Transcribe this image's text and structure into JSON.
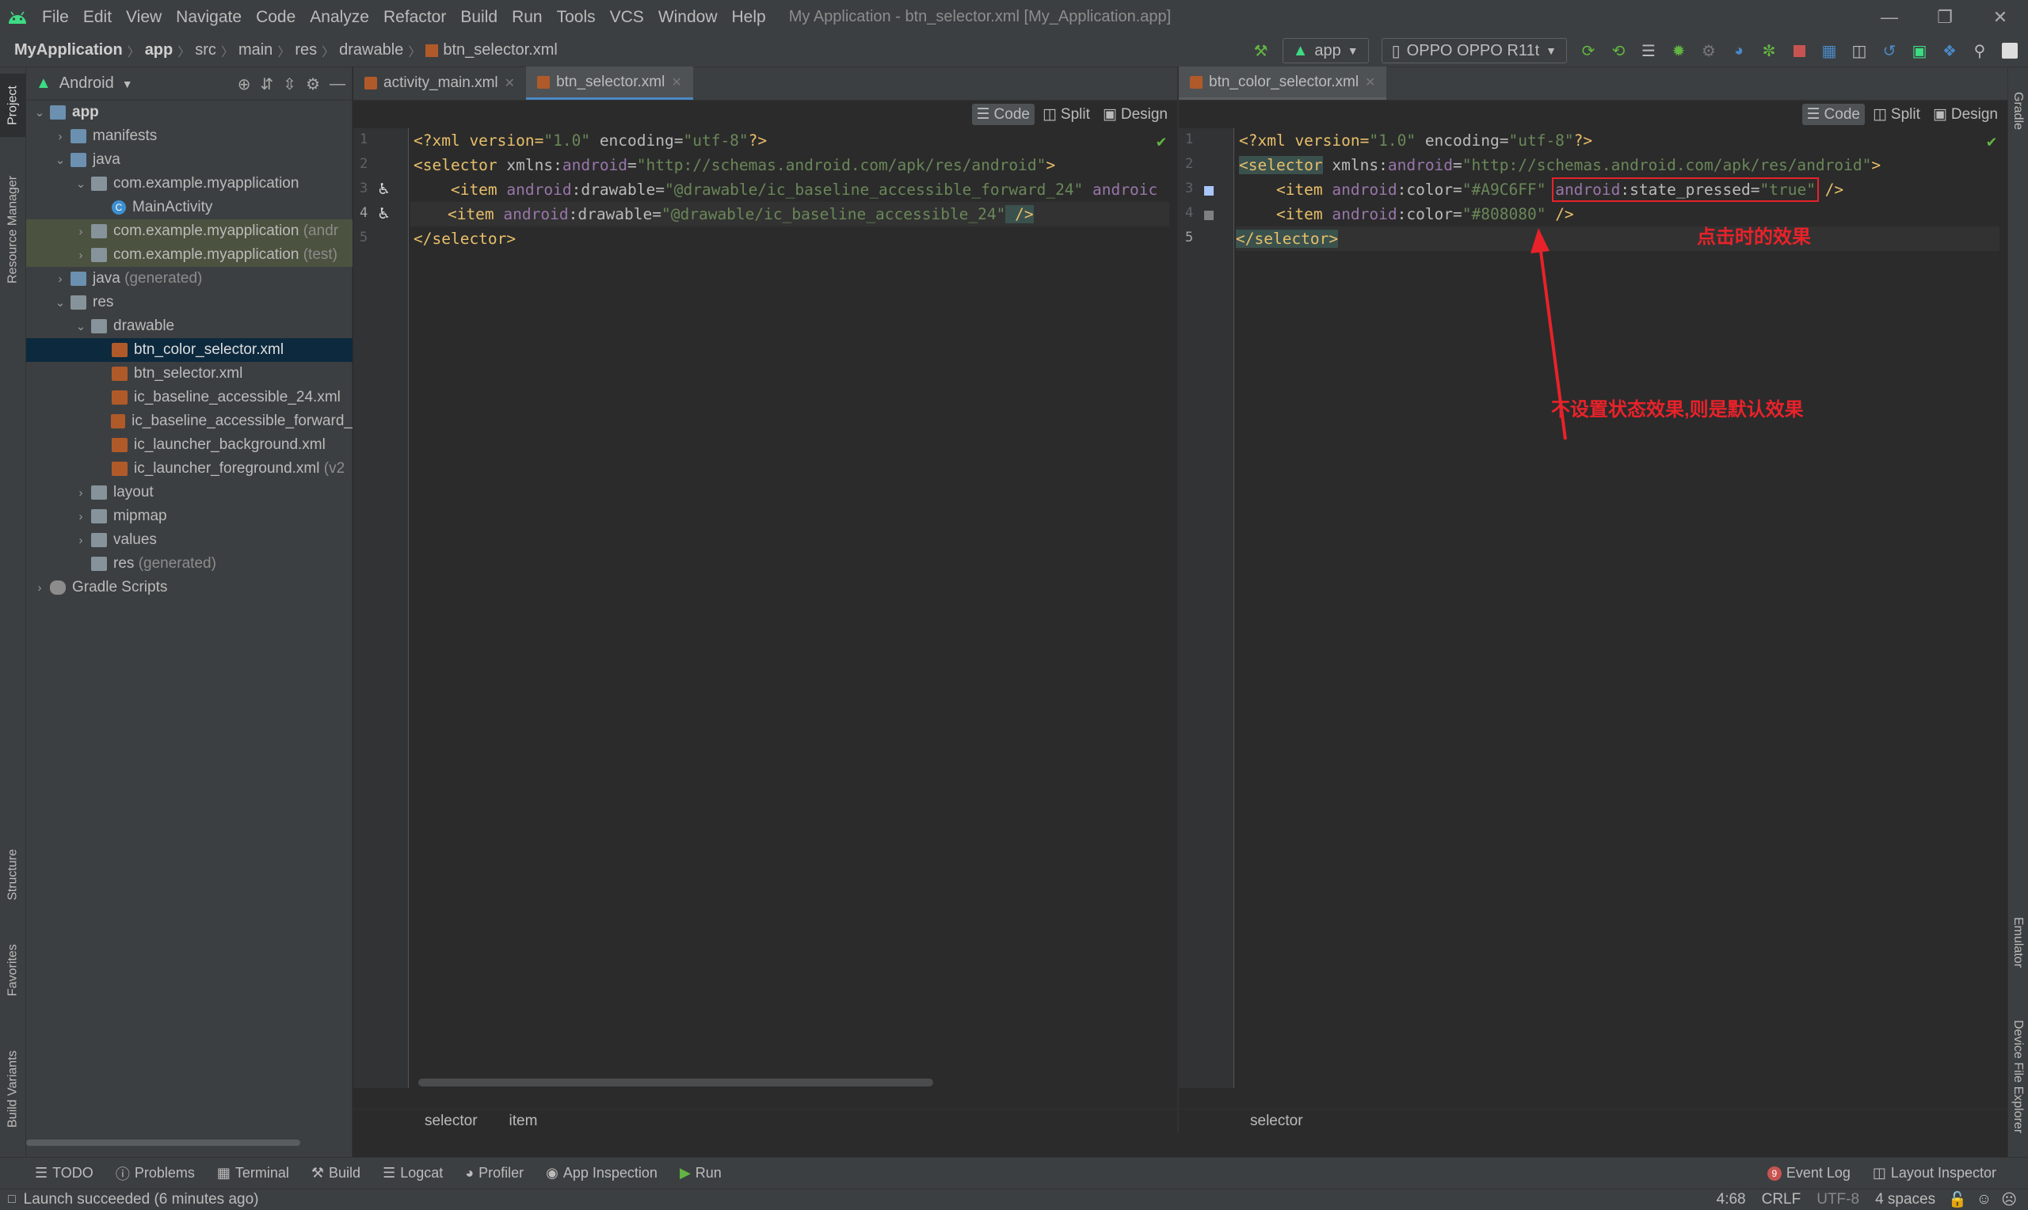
{
  "window": {
    "title": "My Application - btn_selector.xml [My_Application.app]",
    "menu": [
      "File",
      "Edit",
      "View",
      "Navigate",
      "Code",
      "Analyze",
      "Refactor",
      "Build",
      "Run",
      "Tools",
      "VCS",
      "Window",
      "Help"
    ]
  },
  "breadcrumb": [
    "MyApplication",
    "app",
    "src",
    "main",
    "res",
    "drawable",
    "btn_selector.xml"
  ],
  "toolbar": {
    "run_config": "app",
    "device": "OPPO OPPO R11t"
  },
  "project_panel": {
    "view": "Android",
    "tree": [
      {
        "label": "app",
        "bold": true
      },
      {
        "label": "manifests"
      },
      {
        "label": "java"
      },
      {
        "label": "com.example.myapplication"
      },
      {
        "label": "MainActivity"
      },
      {
        "label": "com.example.myapplication",
        "suffix": "(andr"
      },
      {
        "label": "com.example.myapplication",
        "suffix": "(test)"
      },
      {
        "label": "java",
        "suffix": "(generated)"
      },
      {
        "label": "res"
      },
      {
        "label": "drawable"
      },
      {
        "label": "btn_color_selector.xml"
      },
      {
        "label": "btn_selector.xml"
      },
      {
        "label": "ic_baseline_accessible_24.xml"
      },
      {
        "label": "ic_baseline_accessible_forward_"
      },
      {
        "label": "ic_launcher_background.xml"
      },
      {
        "label": "ic_launcher_foreground.xml",
        "suffix": "(v2"
      },
      {
        "label": "layout"
      },
      {
        "label": "mipmap"
      },
      {
        "label": "values"
      },
      {
        "label": "res",
        "suffix": "(generated)"
      },
      {
        "label": "Gradle Scripts"
      }
    ]
  },
  "left_vertical_tabs": [
    "Project",
    "Resource Manager",
    "Structure",
    "Favorites",
    "Build Variants"
  ],
  "right_vertical_tabs": [
    "Gradle",
    "Emulator",
    "Device File Explorer"
  ],
  "editor_left": {
    "tabs": [
      "activity_main.xml",
      "btn_selector.xml"
    ],
    "active_tab": "btn_selector.xml",
    "modes": [
      "Code",
      "Split",
      "Design"
    ],
    "lines": [
      "1",
      "2",
      "3",
      "4",
      "5"
    ],
    "code": {
      "l1": [
        "<?xml version=",
        "\"1.0\"",
        " encoding=",
        "\"utf-8\"",
        "?>"
      ],
      "l2": [
        "<selector ",
        "xmlns:",
        "android",
        "=",
        "\"http://schemas.android.com/apk/res/android\"",
        ">"
      ],
      "l3": [
        "    <item ",
        "android",
        ":drawable=",
        "\"@drawable/ic_baseline_accessible_forward_24\"",
        " androic"
      ],
      "l4": [
        "    <item ",
        "android",
        ":drawable=",
        "\"@drawable/ic_baseline_accessible_24\"",
        " />"
      ],
      "l5": [
        "</selector>"
      ]
    },
    "breadcrumb": [
      "selector",
      "item"
    ]
  },
  "editor_right": {
    "tabs": [
      "btn_color_selector.xml"
    ],
    "active_tab": "btn_color_selector.xml",
    "modes": [
      "Code",
      "Split",
      "Design"
    ],
    "lines": [
      "1",
      "2",
      "3",
      "4",
      "5"
    ],
    "code": {
      "l1": [
        "<?xml version=",
        "\"1.0\"",
        " encoding=",
        "\"utf-8\"",
        "?>"
      ],
      "l2": [
        "<selector",
        " xmlns:",
        "android",
        "=",
        "\"http://schemas.android.com/apk/res/android\"",
        ">"
      ],
      "l3": [
        "    <item ",
        "android",
        ":color=",
        "\"#A9C6FF\"",
        " ",
        "android",
        ":state_pressed=",
        "\"true\"",
        " />"
      ],
      "l4": [
        "    <item ",
        "android",
        ":color=",
        "\"#808080\"",
        " />"
      ],
      "l5": [
        "</selector>"
      ]
    },
    "breadcrumb": [
      "selector"
    ]
  },
  "annotations": {
    "pressed_effect": "点击时的效果",
    "default_effect": "不设置状态效果,则是默认效果",
    "color": "#e8222a"
  },
  "bottom_tools": [
    "TODO",
    "Problems",
    "Terminal",
    "Build",
    "Logcat",
    "Profiler",
    "App Inspection",
    "Run"
  ],
  "bottom_right_tools": {
    "event_log": "Event Log",
    "event_count": "9",
    "layout_inspector": "Layout Inspector"
  },
  "status": {
    "message": "Launch succeeded (6 minutes ago)",
    "position": "4:68",
    "line_sep": "CRLF",
    "encoding": "UTF-8",
    "indent": "4 spaces"
  }
}
